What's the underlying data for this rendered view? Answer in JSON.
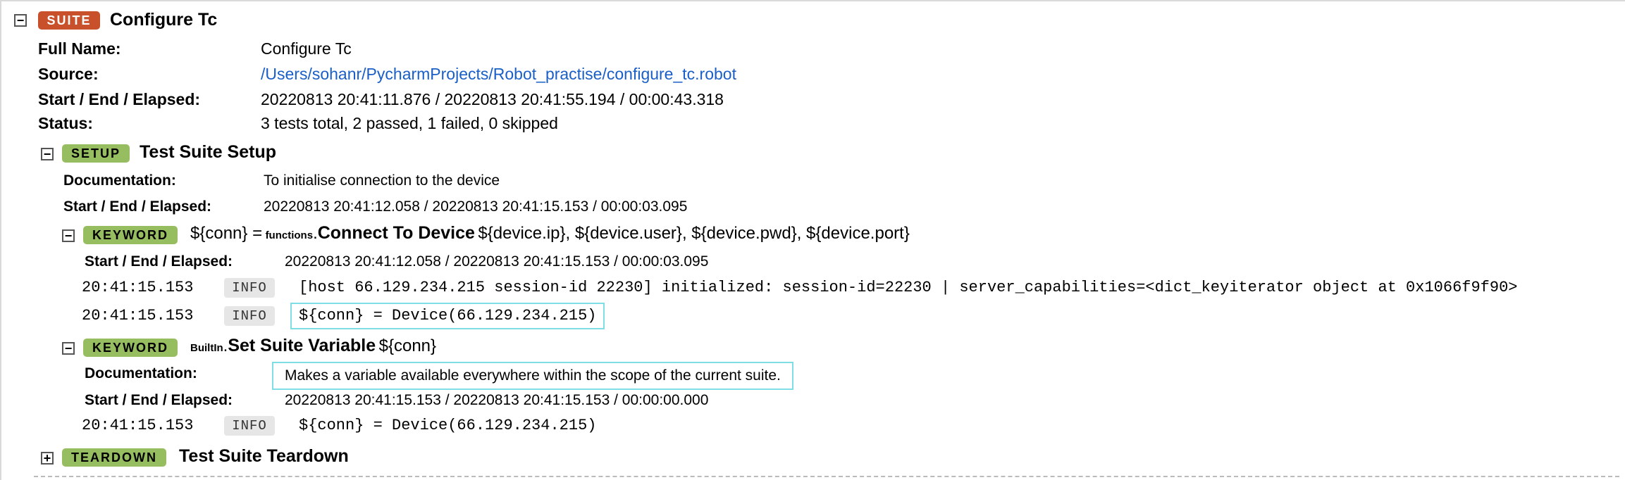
{
  "suite": {
    "badge": "SUITE",
    "title": "Configure Tc",
    "toggle": "−",
    "full_name_label": "Full Name:",
    "full_name_value": "Configure Tc",
    "source_label": "Source:",
    "source_value": "/Users/sohanr/PycharmProjects/Robot_practise/configure_tc.robot",
    "times_label": "Start / End / Elapsed:",
    "times_value": "20220813 20:41:11.876 / 20220813 20:41:55.194 / 00:00:43.318",
    "status_label": "Status:",
    "status_value": "3 tests total, 2 passed, 1 failed, 0 skipped"
  },
  "setup": {
    "badge": "SETUP",
    "title": "Test Suite Setup",
    "toggle": "−",
    "doc_label": "Documentation:",
    "doc_value": "To initialise connection to the device",
    "times_label": "Start / End / Elapsed:",
    "times_value": "20220813 20:41:12.058 / 20220813 20:41:15.153 / 00:00:03.095"
  },
  "keyword1": {
    "badge": "KEYWORD",
    "toggle": "−",
    "assign": "${conn} =",
    "owner": "functions",
    "dot": ".",
    "name": "Connect To Device",
    "args": "${device.ip}, ${device.user}, ${device.pwd}, ${device.port}",
    "times_label": "Start / End / Elapsed:",
    "times_value": "20220813 20:41:12.058 / 20220813 20:41:15.153 / 00:00:03.095",
    "messages": [
      {
        "time": "20:41:15.153",
        "level": "INFO",
        "text": "[host 66.129.234.215 session-id 22230] initialized: session-id=22230 | server_capabilities=<dict_keyiterator object at 0x1066f9f90>"
      },
      {
        "time": "20:41:15.153",
        "level": "INFO",
        "text": "${conn} = Device(66.129.234.215)"
      }
    ]
  },
  "keyword2": {
    "badge": "KEYWORD",
    "toggle": "−",
    "owner": "BuiltIn",
    "dot": ".",
    "name": "Set Suite Variable",
    "args": "${conn}",
    "doc_label": "Documentation:",
    "doc_value": "Makes a variable available everywhere within the scope of the current suite.",
    "times_label": "Start / End / Elapsed:",
    "times_value": "20220813 20:41:15.153 / 20220813 20:41:15.153 / 00:00:00.000",
    "messages": [
      {
        "time": "20:41:15.153",
        "level": "INFO",
        "text": "${conn} = Device(66.129.234.215)"
      }
    ]
  },
  "teardown": {
    "badge": "TEARDOWN",
    "title": "Test Suite Teardown",
    "toggle": "+"
  },
  "colors": {
    "suite_badge": "#c8502a",
    "keyword_badge": "#97bd61",
    "link": "#1a5fc7",
    "highlight": "#7fdde6"
  }
}
